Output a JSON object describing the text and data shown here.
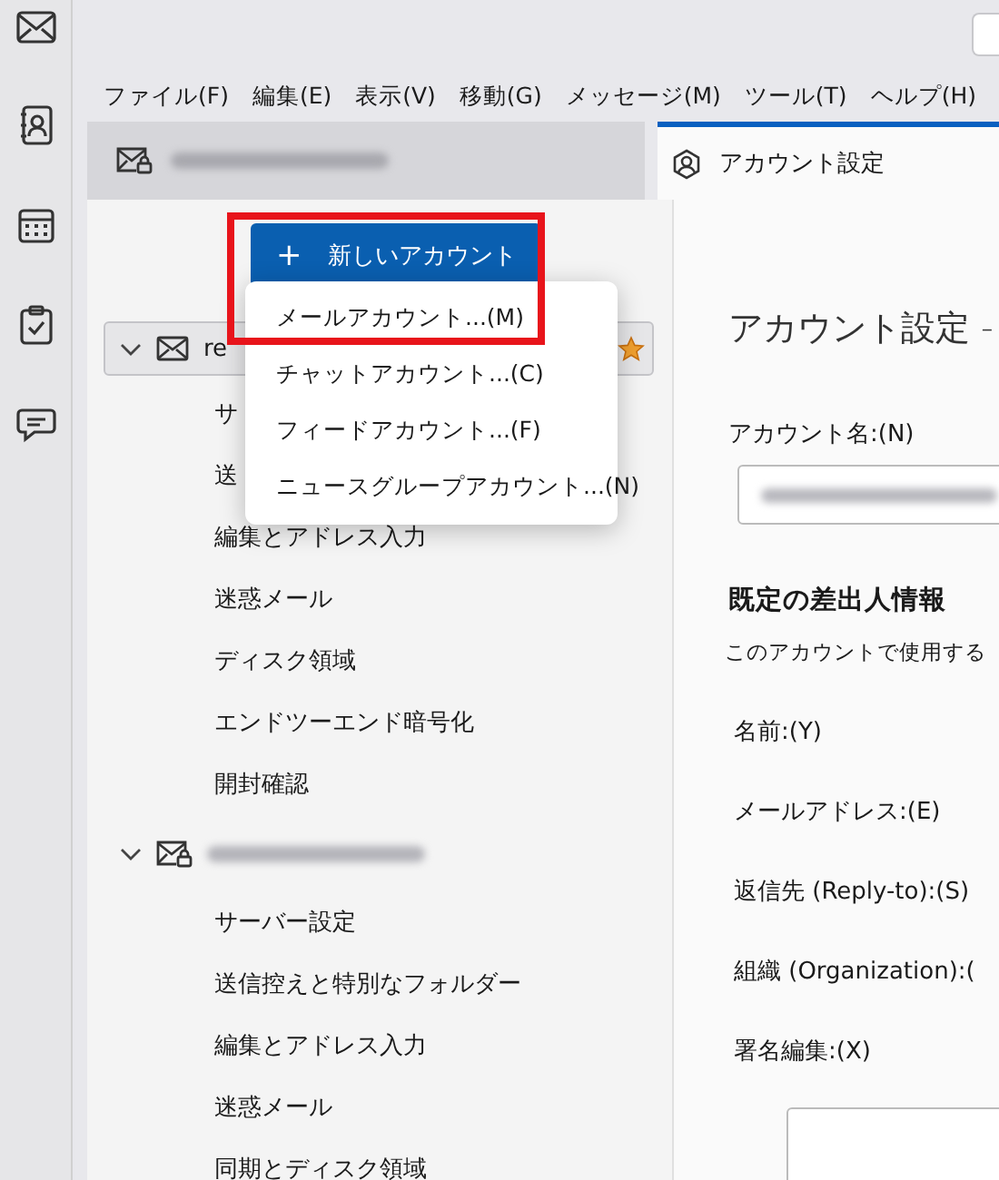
{
  "menu_bar": [
    {
      "label": "ファイル(F)"
    },
    {
      "label": "編集(E)"
    },
    {
      "label": "表示(V)"
    },
    {
      "label": "移動(G)"
    },
    {
      "label": "メッセージ(M)"
    },
    {
      "label": "ツール(T)"
    },
    {
      "label": "ヘルプ(H)"
    }
  ],
  "tabs": [
    {
      "kind": "account",
      "selected": false
    },
    {
      "kind": "settings",
      "label": "アカウント設定",
      "selected": true
    }
  ],
  "new_account_button": {
    "icon": "+",
    "label": "新しいアカウント"
  },
  "new_account_menu": [
    {
      "label": "メールアカウント...(M)"
    },
    {
      "label": "チャットアカウント...(C)"
    },
    {
      "label": "フィードアカウント...(F)"
    },
    {
      "label": "ニュースグループアカウント...(N)"
    }
  ],
  "accounts": [
    {
      "name": "re",
      "expanded": true,
      "selected": true,
      "default": true,
      "children": [
        {
          "label": "サ"
        },
        {
          "label": "送"
        },
        {
          "label": "編集とアドレス入力"
        },
        {
          "label": "迷惑メール"
        },
        {
          "label": "ディスク領域"
        },
        {
          "label": "エンドツーエンド暗号化"
        },
        {
          "label": "開封確認"
        }
      ]
    },
    {
      "expanded": true,
      "selected": false,
      "default": false,
      "children": [
        {
          "label": "サーバー設定"
        },
        {
          "label": "送信控えと特別なフォルダー"
        },
        {
          "label": "編集とアドレス入力"
        },
        {
          "label": "迷惑メール"
        },
        {
          "label": "同期とディスク領域"
        }
      ]
    }
  ],
  "settings": {
    "heading": "アカウント設定 -",
    "account_name_label": "アカウント名:(N)",
    "section_title": "既定の差出人情報",
    "section_note": "このアカウントで使用する",
    "fields": [
      {
        "label": "名前:(Y)"
      },
      {
        "label": "メールアドレス:(E)"
      },
      {
        "label": "返信先 (Reply-to):(S)"
      },
      {
        "label": "組織 (Organization):("
      }
    ],
    "signature_label": "署名編集:(X)"
  }
}
